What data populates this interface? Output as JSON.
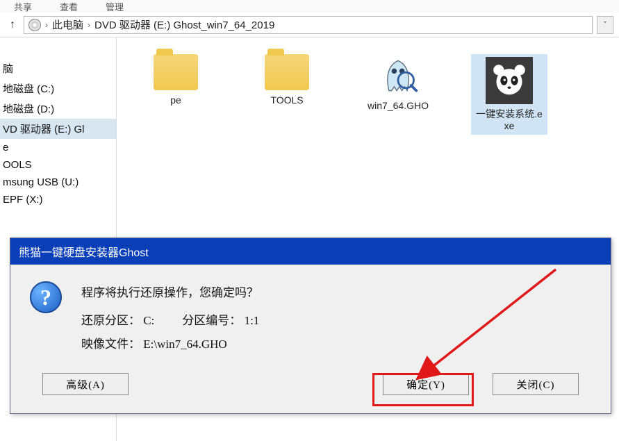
{
  "toolbar": {
    "share": "共享",
    "view": "查看",
    "manage": "管理"
  },
  "breadcrumb": {
    "root": "此电脑",
    "drive": "DVD 驱动器 (E:) Ghost_win7_64_2019"
  },
  "sidebar": {
    "items": [
      {
        "label": "脑"
      },
      {
        "label": "地磁盘 (C:)"
      },
      {
        "label": "地磁盘 (D:)"
      },
      {
        "label": "VD 驱动器 (E:) Gl"
      },
      {
        "label": "e"
      },
      {
        "label": "OOLS"
      },
      {
        "label": "msung USB (U:)"
      },
      {
        "label": "EPF (X:)"
      }
    ],
    "selectedIndex": 3
  },
  "files": [
    {
      "name": "pe",
      "type": "folder"
    },
    {
      "name": "TOOLS",
      "type": "folder"
    },
    {
      "name": "win7_64.GHO",
      "type": "gho"
    },
    {
      "name": "一键安装系统.exe",
      "type": "exe",
      "selected": true
    }
  ],
  "dialog": {
    "title": "熊猫一键硬盘安装器Ghost",
    "message": "程序将执行还原操作，您确定吗？",
    "restore_label": "还原分区：",
    "restore_value": "C:",
    "partnum_label": "分区编号：",
    "partnum_value": "1:1",
    "image_label": "映像文件：",
    "image_value": "E:\\win7_64.GHO",
    "buttons": {
      "advanced": "高级(A)",
      "ok": "确定(Y)",
      "close": "关闭(C)"
    }
  }
}
